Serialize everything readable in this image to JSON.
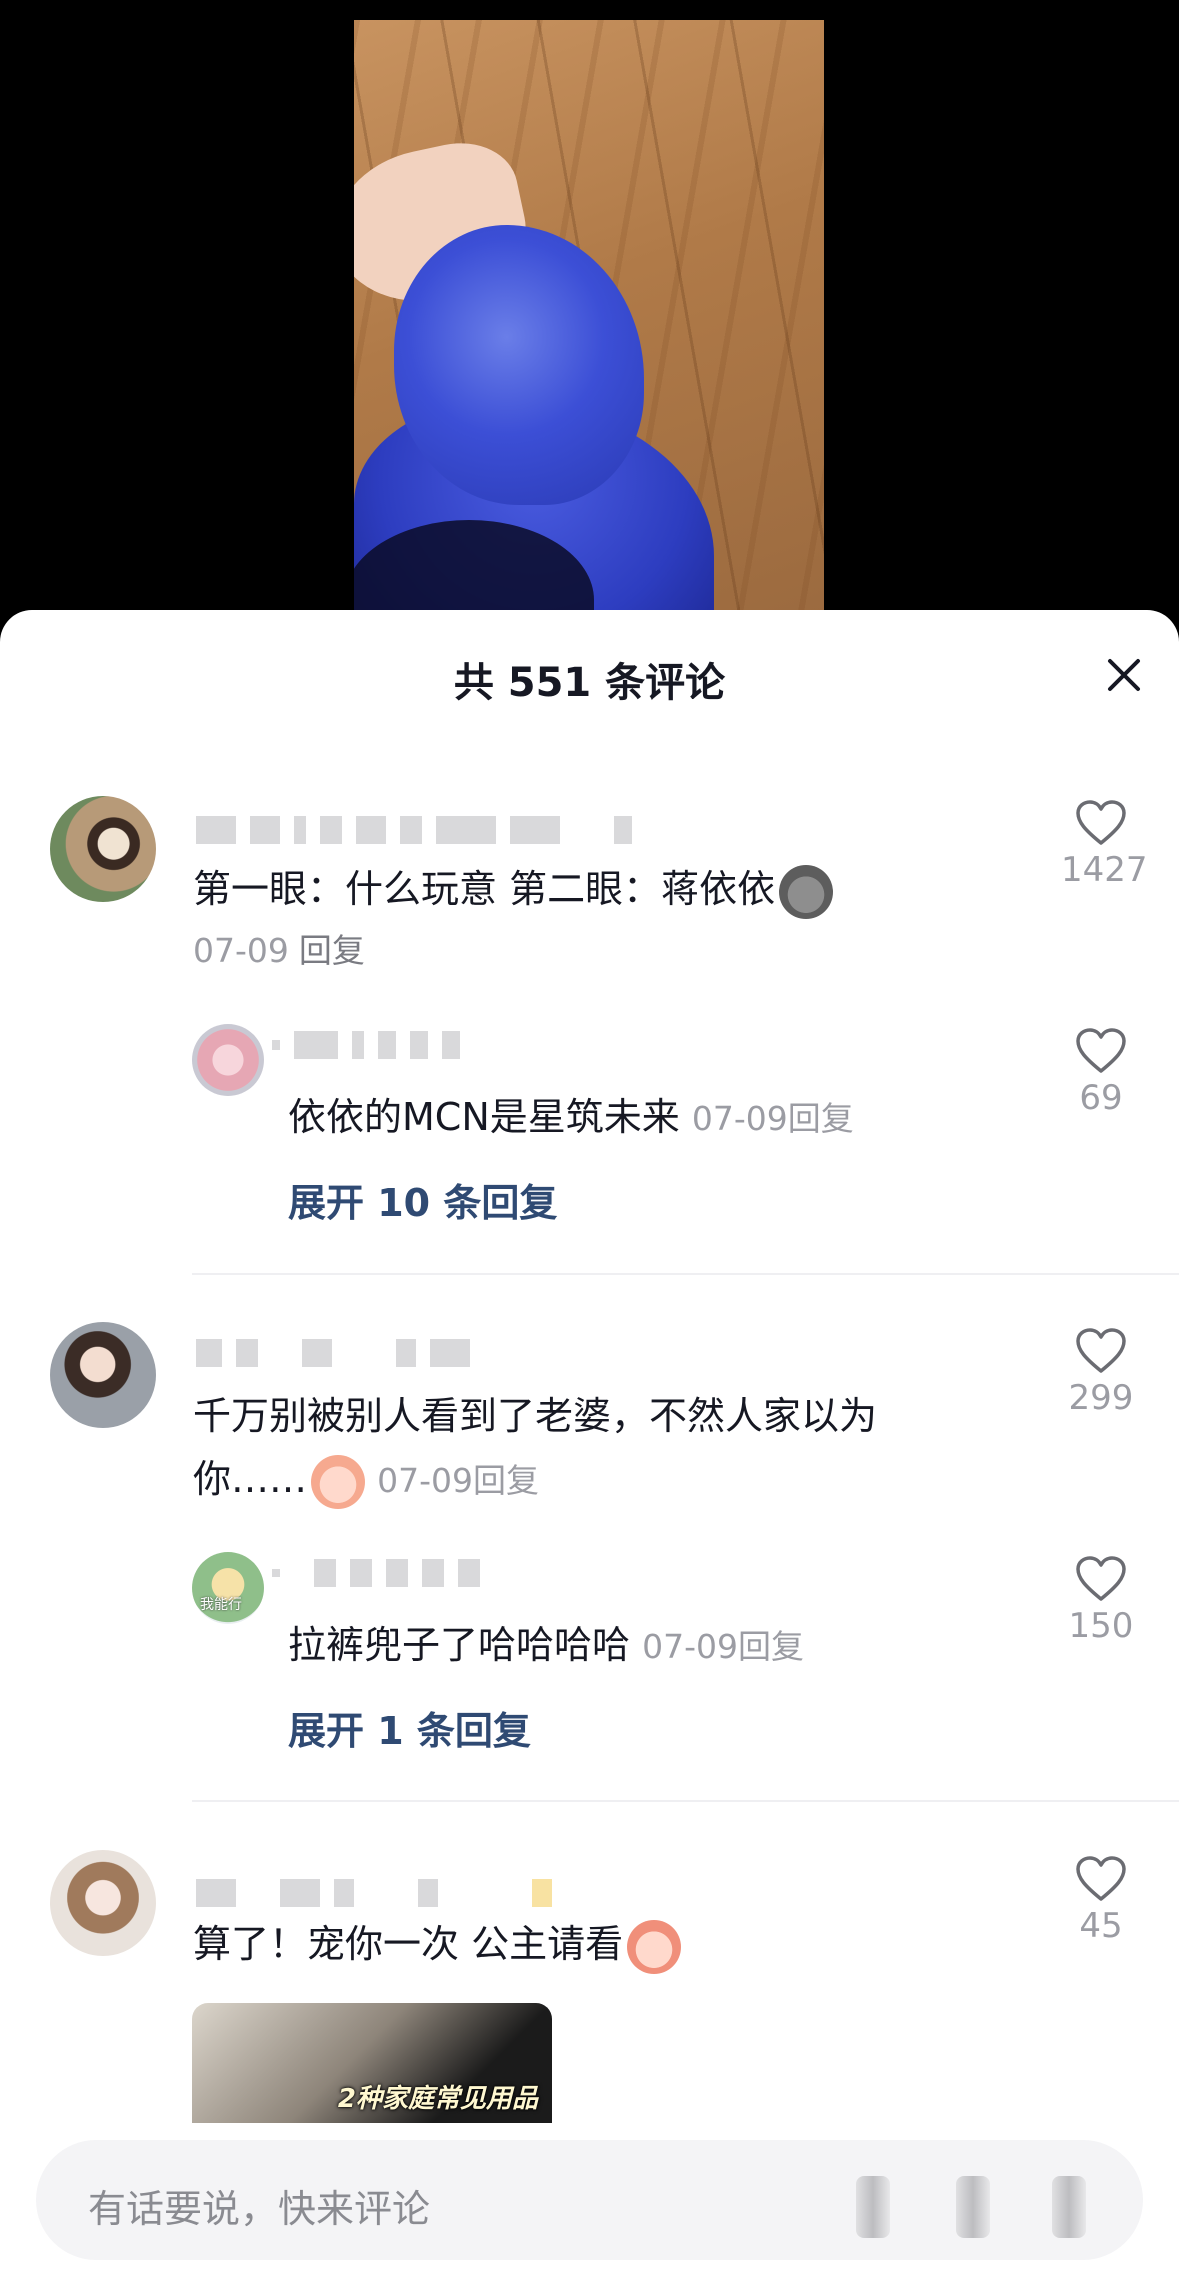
{
  "sheet": {
    "title": "共 551 条评论"
  },
  "comments": [
    {
      "text": "第一眼：什么玩意 第二眼：蒋依依",
      "date": "07-09",
      "reply_label": "回复",
      "likes": "1427",
      "replies": [
        {
          "text": "依依的MCN是星筑未来",
          "date": "07-09",
          "reply_label": "回复",
          "likes": "69"
        }
      ],
      "expand_label": "展开 10 条回复"
    },
    {
      "text_line1": "千万别被别人看到了老婆，不然人家以为",
      "text_line2": "你……",
      "date": "07-09",
      "reply_label": "回复",
      "likes": "299",
      "replies": [
        {
          "text": "拉裤兜子了哈哈哈哈",
          "date": "07-09",
          "reply_label": "回复",
          "likes": "150",
          "avatar_text": "我能行"
        }
      ],
      "expand_label": "展开 1 条回复"
    },
    {
      "text": "算了！宠你一次 公主请看",
      "likes": "45",
      "thumb_caption": "2种家庭常见用品"
    }
  ],
  "input": {
    "placeholder": "有话要说，快来评论"
  },
  "icons": {
    "close": "close-icon",
    "like": "heart-outline-icon",
    "emoji": "emoji-sticker-icon"
  }
}
